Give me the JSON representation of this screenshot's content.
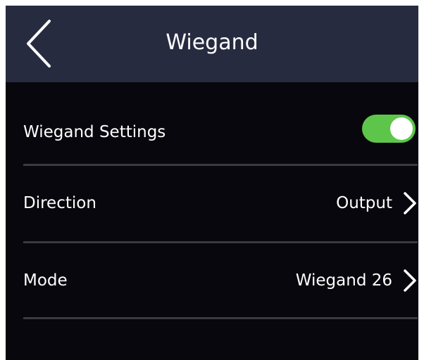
{
  "header": {
    "title": "Wiegand",
    "back_icon": "chevron-left-icon"
  },
  "settings": {
    "wiegand_settings": {
      "label": "Wiegand Settings",
      "enabled": true,
      "toggle_color": "#5dc64a"
    },
    "direction": {
      "label": "Direction",
      "value": "Output",
      "icon": "chevron-right-icon"
    },
    "mode": {
      "label": "Mode",
      "value": "Wiegand 26",
      "icon": "chevron-right-icon"
    }
  },
  "colors": {
    "header_bg": "#272b40",
    "body_bg": "#07070d",
    "divider": "#3a3a3f",
    "text": "#ffffff"
  }
}
